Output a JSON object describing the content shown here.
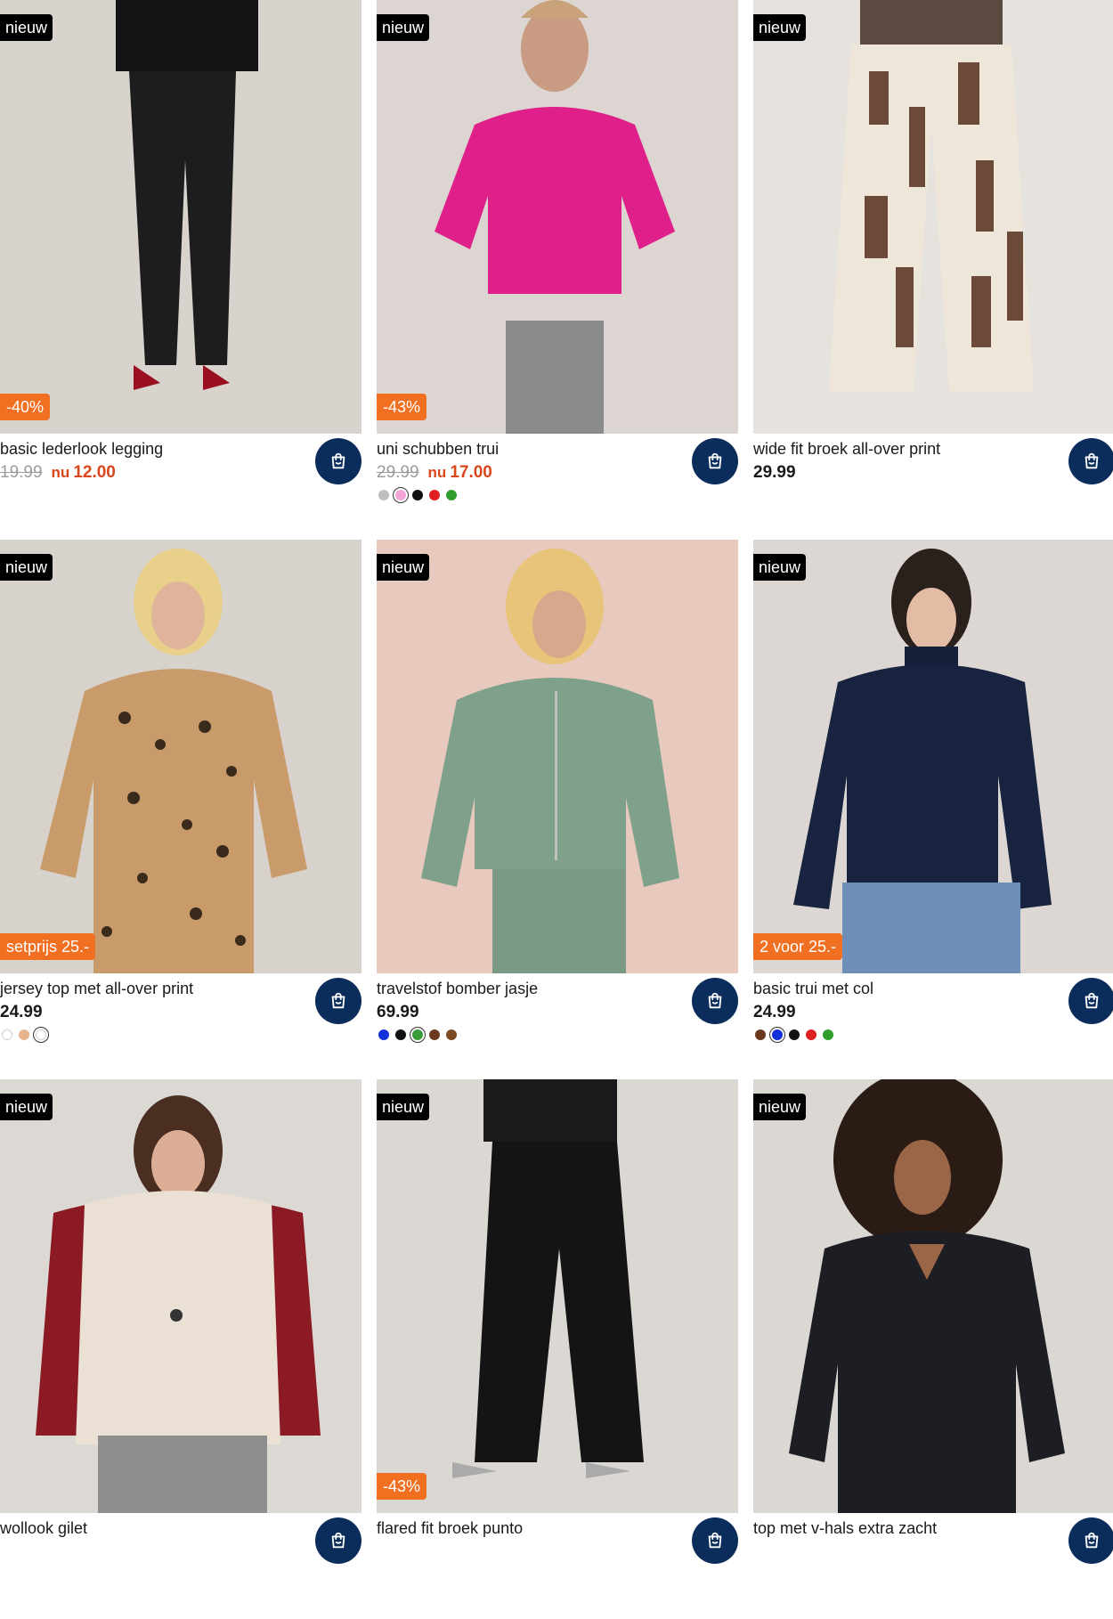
{
  "products": [
    {
      "badge": "nieuw",
      "promo": "-40%",
      "title": "basic lederlook legging",
      "old_price": "19.99",
      "now_label": "nu",
      "new_price": "12.00",
      "price": "",
      "cart_icon": "shopping-bag-icon",
      "colors": [],
      "selected": -1
    },
    {
      "badge": "nieuw",
      "promo": "-43%",
      "title": "uni schubben trui",
      "old_price": "29.99",
      "now_label": "nu",
      "new_price": "17.00",
      "price": "",
      "cart_icon": "shopping-bag-icon",
      "colors": [
        "#bfbfbf",
        "#f2a5d6",
        "#111111",
        "#e02020",
        "#2f9e2f"
      ],
      "selected": 1
    },
    {
      "badge": "nieuw",
      "promo": "",
      "title": "wide fit broek all-over print",
      "old_price": "",
      "now_label": "",
      "new_price": "",
      "price": "29.99",
      "cart_icon": "shopping-bag-icon",
      "colors": [],
      "selected": -1
    },
    {
      "badge": "nieuw",
      "promo": "setprijs 25.-",
      "title": "jersey top met all-over print",
      "old_price": "",
      "now_label": "",
      "new_price": "",
      "price": "24.99",
      "cart_icon": "shopping-bag-icon",
      "colors": [
        "#ffffff",
        "#e8b48f",
        "#ffffff"
      ],
      "selected": 2
    },
    {
      "badge": "nieuw",
      "promo": "",
      "title": "travelstof bomber jasje",
      "old_price": "",
      "now_label": "",
      "new_price": "",
      "price": "69.99",
      "cart_icon": "shopping-bag-icon",
      "colors": [
        "#1230d9",
        "#111111",
        "#3a9b3a",
        "#6b3a1e",
        "#7a4a22"
      ],
      "selected": 2
    },
    {
      "badge": "nieuw",
      "promo": "2 voor 25.-",
      "title": "basic trui met col",
      "old_price": "",
      "now_label": "",
      "new_price": "",
      "price": "24.99",
      "cart_icon": "shopping-bag-icon",
      "colors": [
        "#6b3a1e",
        "#1230d9",
        "#111111",
        "#e02020",
        "#2f9e2f"
      ],
      "selected": 1
    },
    {
      "badge": "nieuw",
      "promo": "",
      "title": "wollook gilet",
      "old_price": "",
      "now_label": "",
      "new_price": "",
      "price": "",
      "cart_icon": "shopping-bag-icon",
      "colors": [],
      "selected": -1
    },
    {
      "badge": "nieuw",
      "promo": "-43%",
      "title": "flared fit broek punto",
      "old_price": "",
      "now_label": "",
      "new_price": "",
      "price": "",
      "cart_icon": "shopping-bag-icon",
      "colors": [],
      "selected": -1
    },
    {
      "badge": "nieuw",
      "promo": "",
      "title": "top met v-hals extra zacht",
      "old_price": "",
      "now_label": "",
      "new_price": "",
      "price": "",
      "cart_icon": "shopping-bag-icon",
      "colors": [],
      "selected": -1
    }
  ],
  "colors": {
    "cart_button": "#0b2d5c",
    "promo_badge": "#f06f21",
    "sale_price": "#d9471b",
    "new_badge": "#000000"
  }
}
